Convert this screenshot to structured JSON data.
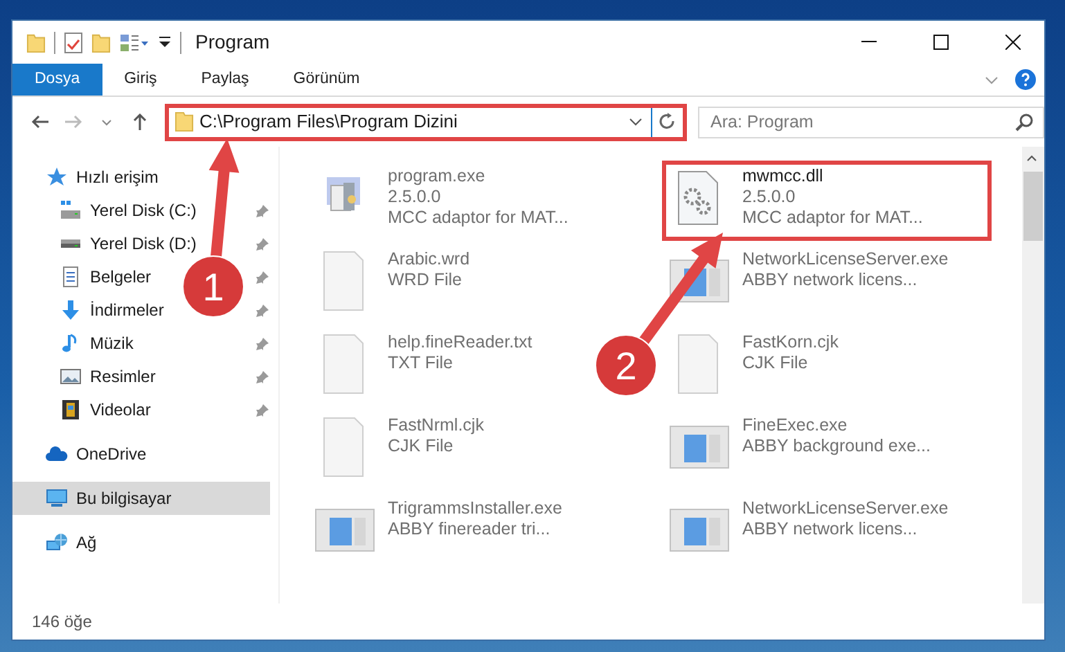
{
  "window": {
    "title": "Program"
  },
  "ribbon_tabs": [
    {
      "label": "Dosya",
      "selected": true
    },
    {
      "label": "Giriş",
      "selected": false
    },
    {
      "label": "Paylaş",
      "selected": false
    },
    {
      "label": "Görünüm",
      "selected": false
    }
  ],
  "address_bar": {
    "value": "C:\\Program Files\\Program Dizini",
    "highlighted": true
  },
  "search": {
    "placeholder": "Ara: Program"
  },
  "sidebar": {
    "items": [
      {
        "label": "Hızlı erişim",
        "kind": "star",
        "selected": false,
        "children": [
          {
            "label": "Yerel Disk (C:)",
            "kind": "system-drive",
            "pinned": true,
            "selected": false
          },
          {
            "label": "Yerel Disk (D:)",
            "kind": "drive",
            "pinned": true,
            "selected": false
          },
          {
            "label": "Belgeler",
            "kind": "documents",
            "pinned": true,
            "selected": false
          },
          {
            "label": "İndirmeler",
            "kind": "downloads",
            "pinned": true,
            "selected": false
          },
          {
            "label": "Müzik",
            "kind": "music",
            "pinned": true,
            "selected": false
          },
          {
            "label": "Resimler",
            "kind": "pictures",
            "pinned": true,
            "selected": false
          },
          {
            "label": "Videolar",
            "kind": "videos",
            "pinned": true,
            "selected": false
          }
        ]
      },
      {
        "label": "OneDrive",
        "kind": "cloud",
        "selected": false
      },
      {
        "label": "Bu bilgisayar",
        "kind": "computer",
        "selected": true
      },
      {
        "label": "Ağ",
        "kind": "network",
        "selected": false
      }
    ]
  },
  "files": [
    {
      "name": "program.exe",
      "details": [
        "2.5.0.0",
        "MCC adaptor for MAT..."
      ],
      "kind": "installer",
      "faded": true,
      "highlighted": false
    },
    {
      "name": "mwmcc.dll",
      "details": [
        "2.5.0.0",
        "MCC adaptor for MAT..."
      ],
      "kind": "library",
      "faded": false,
      "highlighted": true
    },
    {
      "name": "Arabic.wrd",
      "details": [
        "WRD File"
      ],
      "kind": "document",
      "faded": true,
      "highlighted": false
    },
    {
      "name": "NetworkLicenseServer.exe",
      "details": [
        "ABBY network licens..."
      ],
      "kind": "application",
      "faded": true,
      "highlighted": false
    },
    {
      "name": "help.fineReader.txt",
      "details": [
        "TXT File"
      ],
      "kind": "document",
      "faded": true,
      "highlighted": false
    },
    {
      "name": "FastKorn.cjk",
      "details": [
        "CJK File"
      ],
      "kind": "document",
      "faded": true,
      "highlighted": false
    },
    {
      "name": "FastNrml.cjk",
      "details": [
        "CJK File"
      ],
      "kind": "document",
      "faded": true,
      "highlighted": false
    },
    {
      "name": "FineExec.exe",
      "details": [
        "ABBY background exe..."
      ],
      "kind": "application",
      "faded": true,
      "highlighted": false
    },
    {
      "name": "TrigrammsInstaller.exe",
      "details": [
        "ABBY finereader tri..."
      ],
      "kind": "application",
      "faded": true,
      "highlighted": false
    },
    {
      "name": "NetworkLicenseServer.exe",
      "details": [
        "ABBY network licens..."
      ],
      "kind": "application",
      "faded": true,
      "highlighted": false
    }
  ],
  "status_bar": {
    "item_count": "146 öğe"
  },
  "callouts": [
    {
      "label": "1"
    },
    {
      "label": "2"
    }
  ]
}
